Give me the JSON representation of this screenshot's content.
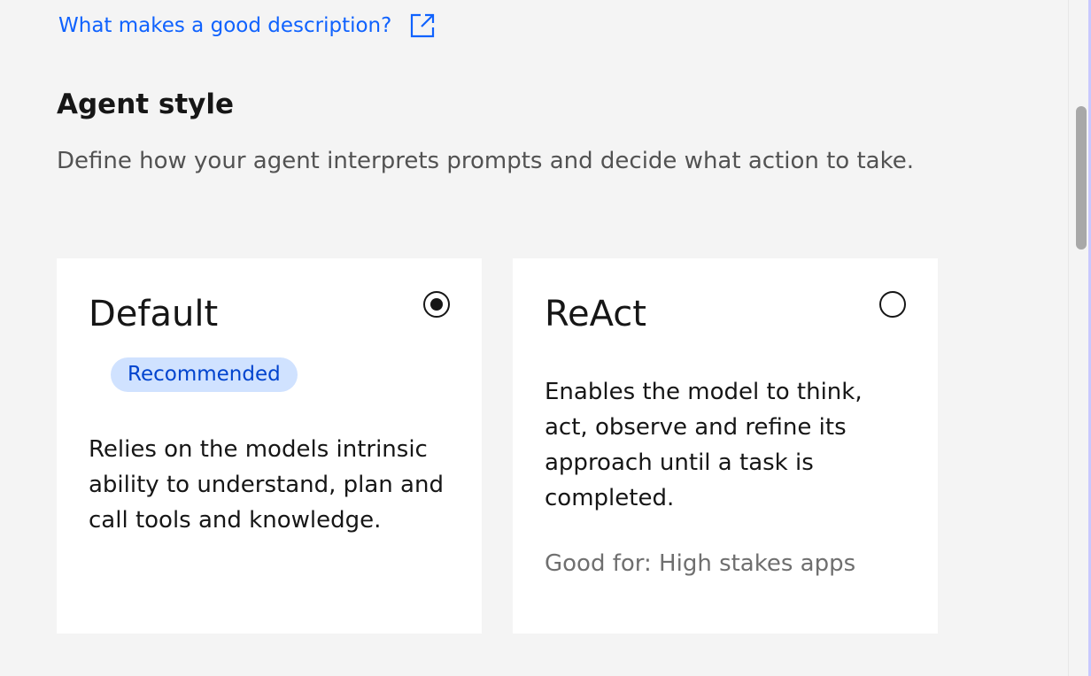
{
  "help_link": {
    "label": "What makes a good description?",
    "icon": "launch-icon"
  },
  "agent_style": {
    "title": "Agent style",
    "description": "Define how your agent interprets prompts and decide what action to take.",
    "options": [
      {
        "title": "Default",
        "selected": true,
        "tag": "Recommended",
        "description": "Relies on the models intrinsic ability to understand, plan and call tools and knowledge."
      },
      {
        "title": "ReAct",
        "selected": false,
        "description": "Enables the model to think, act, observe and refine its approach until a task is completed.",
        "good_for": "Good for: High stakes apps"
      }
    ]
  },
  "colors": {
    "link": "#0f62fe",
    "tag_background": "#d0e2ff",
    "tag_text": "#0043ce",
    "page_background": "#f4f4f4"
  }
}
